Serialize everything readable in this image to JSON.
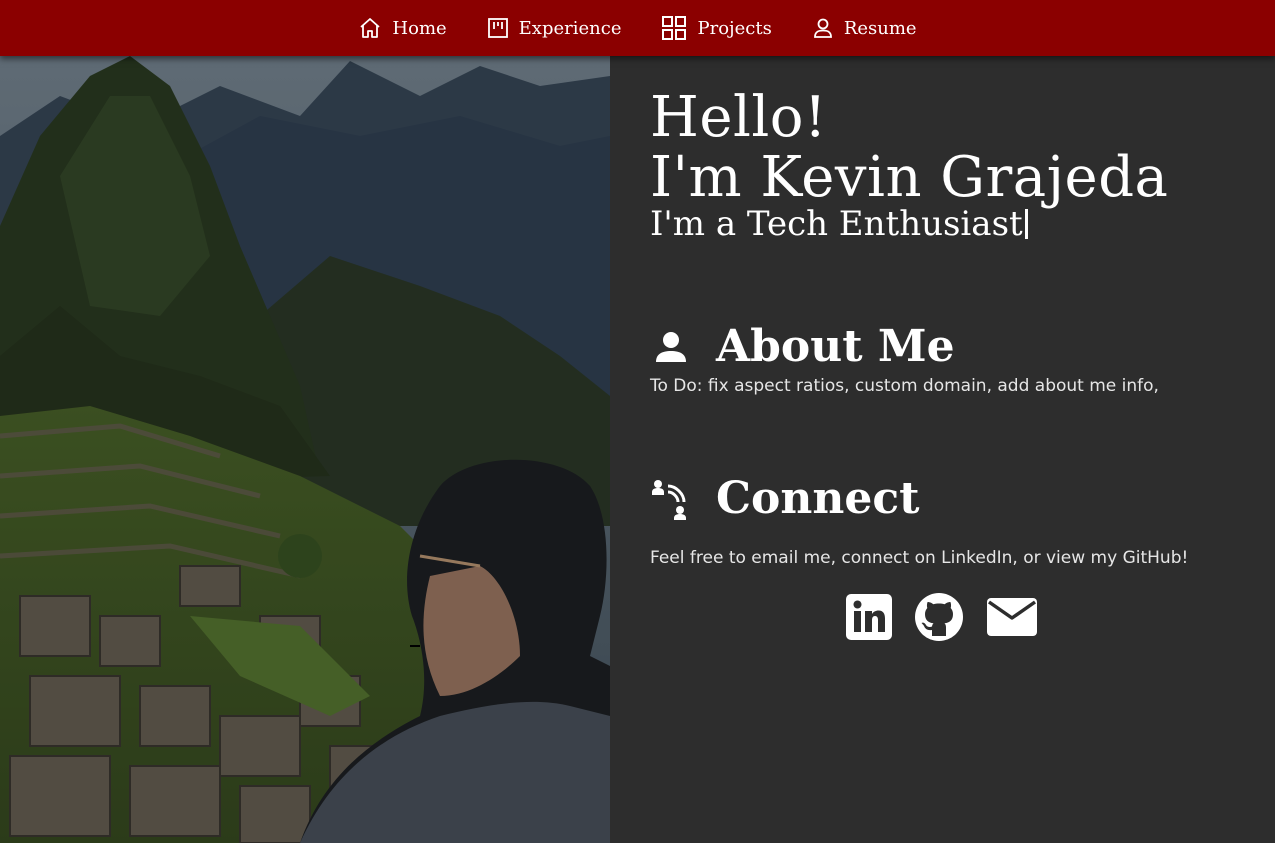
{
  "nav": {
    "items": [
      {
        "label": "Home",
        "icon": "home-icon"
      },
      {
        "label": "Experience",
        "icon": "board-icon"
      },
      {
        "label": "Projects",
        "icon": "grid-icon"
      },
      {
        "label": "Resume",
        "icon": "person-icon"
      }
    ]
  },
  "hero": {
    "greeting_line1": "Hello!",
    "greeting_line2": "I'm Kevin Grajeda",
    "tagline": "I'm a Tech Enthusiast"
  },
  "about": {
    "title": "About Me",
    "icon": "person-icon",
    "text": "To Do: fix aspect ratios, custom domain, add about me info,"
  },
  "connect": {
    "title": "Connect",
    "icon": "connect-icon",
    "text": "Feel free to email me, connect on LinkedIn, or view my GitHub!",
    "links": [
      {
        "name": "LinkedIn",
        "icon": "linkedin-icon"
      },
      {
        "name": "GitHub",
        "icon": "github-icon"
      },
      {
        "name": "Email",
        "icon": "email-icon"
      }
    ]
  },
  "colors": {
    "navbar": "#8b0000",
    "background": "#2d2d2d",
    "text": "#ffffff"
  }
}
